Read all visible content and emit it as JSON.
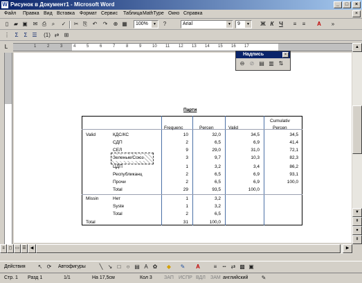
{
  "window": {
    "title": "Рисунок в Документ1 - Microsoft Word",
    "icon": "W",
    "min": "_",
    "max": "□",
    "close": "×"
  },
  "menu": [
    "Файл",
    "Правка",
    "Вид",
    "Вставка",
    "Формат",
    "Сервис",
    "Таблица",
    "MathType",
    "Окно",
    "Справка"
  ],
  "toolbar": {
    "zoom": "100%",
    "font": "Arial",
    "size": "9"
  },
  "float_toolbar": {
    "title": "Надпись"
  },
  "ruler_labels": [
    "1",
    "2",
    "3",
    "4",
    "5",
    "6",
    "7",
    "8",
    "9",
    "10",
    "11",
    "12",
    "13",
    "14",
    "15",
    "16",
    "17"
  ],
  "table": {
    "title": "Парти",
    "headers": {
      "frequency": "Frequenc",
      "percent": "Percen",
      "valid": "Valid",
      "cumulative": "Cumulativ",
      "cumulative2": "Percen"
    },
    "section_valid": "Valid",
    "section_missing": "Missin",
    "total_label": "Total",
    "rows": [
      {
        "label": "КДС/КС",
        "freq": "10",
        "pct": "32,0",
        "valid": "34,5",
        "cum": "34,5"
      },
      {
        "label": "СДП",
        "freq": "2",
        "pct": "6,5",
        "valid": "6,9",
        "cum": "41,4"
      },
      {
        "label": "СЕЛ",
        "freq": "9",
        "pct": "29,0",
        "valid": "31,0",
        "cum": "72,1"
      },
      {
        "label": "Зеленые/Союз",
        "freq": "3",
        "pct": "9,7",
        "valid": "10,3",
        "cum": "82,3"
      },
      {
        "label": "ЦДП",
        "freq": "1",
        "pct": "3,2",
        "valid": "3,4",
        "cum": "86,2"
      },
      {
        "label": "Республиканц",
        "freq": "2",
        "pct": "6,5",
        "valid": "6,9",
        "cum": "93,1"
      },
      {
        "label": "Прочи",
        "freq": "2",
        "pct": "6,5",
        "valid": "6,9",
        "cum": "100,0"
      },
      {
        "label": "Total",
        "freq": "29",
        "pct": "93,5",
        "valid": "100,0",
        "cum": ""
      }
    ],
    "missing_rows": [
      {
        "label": "Нет",
        "freq": "1",
        "pct": "3,2"
      },
      {
        "label": "Syste",
        "freq": "1",
        "pct": "3,2"
      },
      {
        "label": "Total",
        "freq": "2",
        "pct": "6,5"
      }
    ],
    "grand_total": {
      "freq": "31",
      "pct": "100,0"
    }
  },
  "drawing_bar": {
    "actions": "Действия",
    "autoshapes": "Автофигуры"
  },
  "status": {
    "page": "Стр. 1",
    "section": "Разд 1",
    "pages": "1/1",
    "at": "На 17,5см",
    "col": "Кол 3",
    "rec": "ЗАП",
    "trk": "ИСПР",
    "ext": "ВДЛ",
    "ovr": "ЗАМ",
    "lang": "английский"
  }
}
